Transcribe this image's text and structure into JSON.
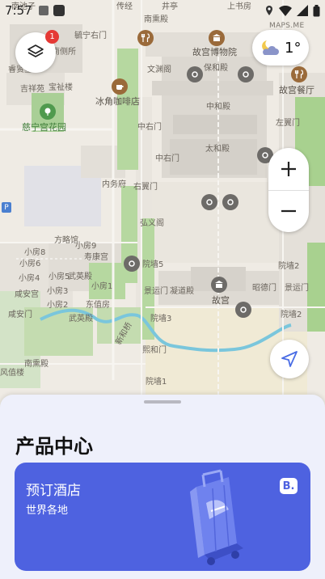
{
  "status_bar": {
    "time": "7:57"
  },
  "map": {
    "attribution": "MAPS.ME",
    "labels": {
      "nanchi": "南池子",
      "chuanjing": "传经",
      "jingle": "井亭",
      "shangshu": "上书房",
      "lanjiao": "南熏殿",
      "qiangsanso": "毓宁右门",
      "nanhousuo": "南侧所",
      "ruixian": "睿贤堂",
      "jixiang": "吉祥苑",
      "baoshan": "宝祉楼",
      "bingmei": "冰角咖啡店",
      "cininggarden": "慈宁宫花园",
      "museum": "故宫博物院",
      "baohe": "保和殿",
      "zhonghe": "中和殿",
      "taihe": "太和殿",
      "zuoyi": "左翼门",
      "gugongcanting": "故宫餐厅",
      "wenyuan": "文渊阁",
      "zhongyou": "中右门",
      "youyi": "右翼门",
      "neiwufu": "内务府",
      "hongyi": "弘义阁",
      "xiaofang9": "小房9",
      "xiaofang8": "小房8",
      "fangyi": "方略馆",
      "shoukang": "寿康宫",
      "xiaofang6": "小房6",
      "xiaofang5": "小房5",
      "xiaofang4": "小房4",
      "xiaofang3": "小房3",
      "xiaofang2": "小房2",
      "xiaofang1": "小房1",
      "wuying": "武英殿",
      "xianan": "咸安宫",
      "xianyou": "咸安门",
      "dongzhi": "东值房",
      "yuanmen": "院墙5",
      "xiaofang2b": "小房2",
      "ningdong": "凝道殿",
      "gugong": "故宫",
      "zhaode": "昭德门",
      "jingyun": "景运门",
      "xihuamen": "熙和门",
      "yuanmen2": "院墙2",
      "nandun": "南熏殿",
      "yuanmen3": "院墙3",
      "yuanmen1": "院墙1",
      "fengzhi": "风值楼",
      "wenhuadian": "文华殿",
      "xinhe": "新和桥",
      "taihemen": "太和门",
      "xiehe": "协和门"
    }
  },
  "weather": {
    "temp": "1°"
  },
  "layers_badge": "1",
  "sheet": {
    "title": "产品中心",
    "card": {
      "title": "预订酒店",
      "subtitle": "世界各地",
      "logo": "B."
    }
  }
}
